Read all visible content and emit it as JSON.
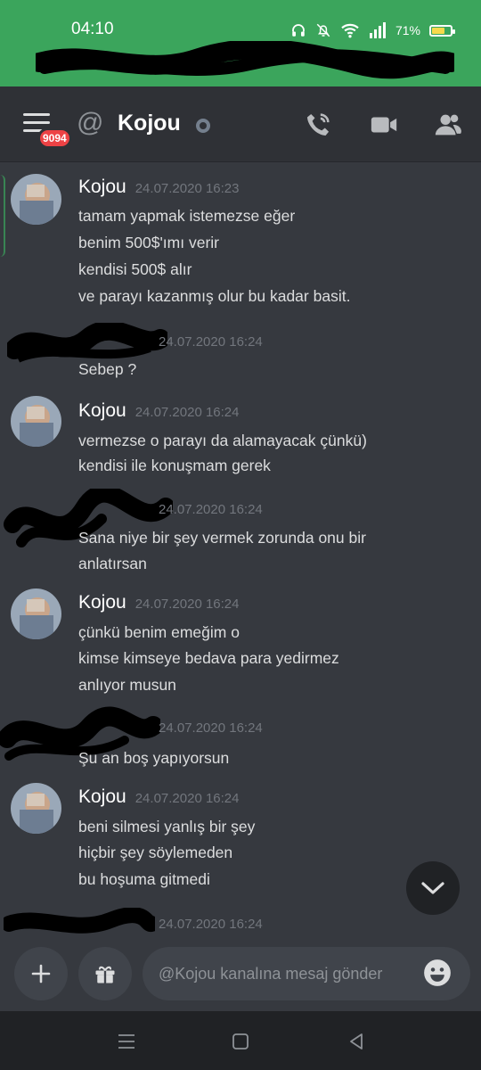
{
  "status_bar": {
    "time": "04:10",
    "battery_percent": "71%",
    "battery_level": 0.71,
    "icons": [
      "headphones-icon",
      "bell-muted-icon",
      "wifi-icon",
      "signal-icon",
      "battery-icon"
    ]
  },
  "header": {
    "notification_badge": "9094",
    "channel_name": "Kojou",
    "icons": [
      "menu-icon",
      "at-icon",
      "call-icon",
      "video-icon",
      "members-icon"
    ]
  },
  "messages": [
    {
      "author": "Kojou",
      "timestamp": "24.07.2020 16:23",
      "lines": [
        "tamam yapmak istemezse eğer",
        "benim 500$'ımı verir",
        "kendisi 500$ alır",
        "ve parayı kazanmış olur bu kadar basit."
      ]
    },
    {
      "author": "",
      "timestamp": "24.07.2020 16:24",
      "lines": [
        "Sebep ?"
      ]
    },
    {
      "author": "Kojou",
      "timestamp": "24.07.2020 16:24",
      "lines": [
        "vermezse o parayı da alamayacak çünkü)",
        "kendisi ile konuşmam gerek"
      ]
    },
    {
      "author": "",
      "timestamp": "24.07.2020 16:24",
      "lines": [
        "Sana niye bir şey vermek zorunda onu bir",
        "anlatırsan"
      ]
    },
    {
      "author": "Kojou",
      "timestamp": "24.07.2020 16:24",
      "lines": [
        "çünkü benim emeğim o",
        "kimse kimseye bedava para yedirmez",
        "anlıyor musun"
      ]
    },
    {
      "author": "",
      "timestamp": "24.07.2020 16:24",
      "lines": [
        "Şu an boş yapıyorsun"
      ]
    },
    {
      "author": "Kojou",
      "timestamp": "24.07.2020 16:24",
      "lines": [
        "beni silmesi yanlış bir şey",
        "hiçbir şey söylemeden",
        "bu hoşuma gitmedi"
      ]
    },
    {
      "author": "",
      "timestamp": "24.07.2020 16:24",
      "lines": []
    }
  ],
  "composer": {
    "placeholder": "@Kojou kanalına mesaj gönder"
  },
  "colors": {
    "status_green": "#3ba55c",
    "background": "#36393f",
    "header": "#2f3136",
    "badge_red": "#ed4245"
  }
}
